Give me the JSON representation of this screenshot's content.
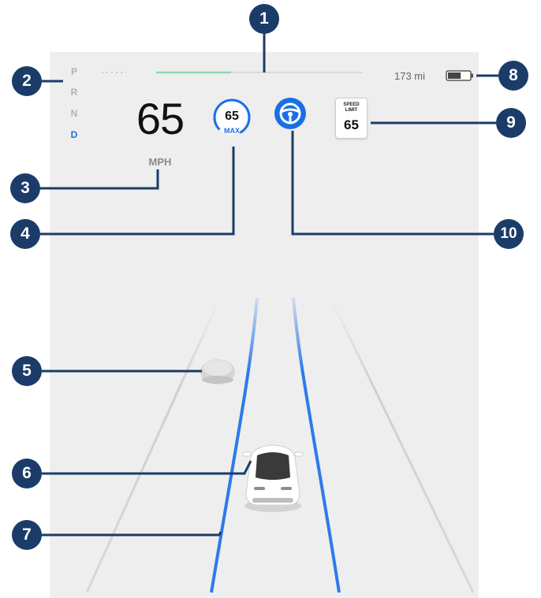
{
  "gears": [
    "P",
    "R",
    "N",
    "D"
  ],
  "active_gear": "D",
  "speed": {
    "value": "65",
    "unit": "MPH"
  },
  "set_speed": {
    "value": "65",
    "label": "MAX"
  },
  "range": {
    "label": "173 mi",
    "charge_fraction": 0.6
  },
  "speed_limit_sign": {
    "title": "SPEED\nLIMIT",
    "value": "65"
  },
  "callouts": [
    "1",
    "2",
    "3",
    "4",
    "5",
    "6",
    "7",
    "8",
    "9",
    "10"
  ],
  "colors": {
    "accent_blue": "#1a6fe6",
    "callout_navy": "#1b3c68",
    "lane_blue": "#2e7ae8",
    "following_green": "#8fd9b0",
    "screen_gray": "#eeeeee"
  },
  "icons": {
    "autosteer": "steering-wheel-icon",
    "battery": "battery-icon"
  }
}
